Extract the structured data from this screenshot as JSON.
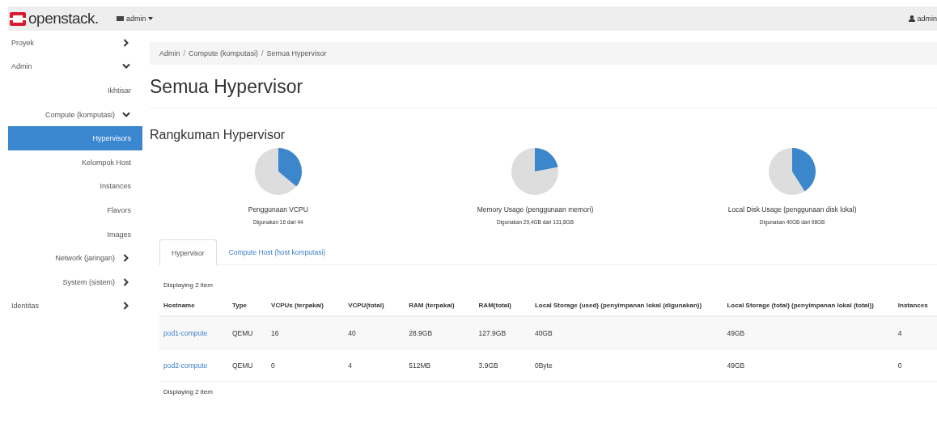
{
  "topbar": {
    "brand": "openstack.",
    "project_menu": "admin",
    "user_menu": "admin"
  },
  "sidebar": {
    "items": [
      {
        "label": "Proyek",
        "expanded": false,
        "selected": false
      },
      {
        "label": "Admin",
        "expanded": true,
        "selected": false,
        "children": [
          {
            "label": "Ikhtisar",
            "selected": false
          },
          {
            "label": "Compute (komputasi)",
            "expanded": true,
            "selected": false,
            "children": [
              {
                "label": "Hypervisors",
                "selected": true
              },
              {
                "label": "Kelompok Host",
                "selected": false
              },
              {
                "label": "Instances",
                "selected": false
              },
              {
                "label": "Flavors",
                "selected": false
              },
              {
                "label": "Images",
                "selected": false
              }
            ]
          },
          {
            "label": "Network (jaringan)",
            "expanded": false,
            "selected": false
          },
          {
            "label": "System (sistem)",
            "expanded": false,
            "selected": false
          }
        ]
      },
      {
        "label": "Identitas",
        "expanded": false,
        "selected": false
      }
    ]
  },
  "breadcrumb": [
    "Admin",
    "Compute (komputasi)",
    "Semua Hypervisor"
  ],
  "breadcrumb_separator": "/",
  "page_title": "Semua Hypervisor",
  "summary": {
    "title": "Rangkuman Hypervisor",
    "meters": [
      {
        "label": "Penggunaan VCPU",
        "detail": "Digunakan 16 dari 44"
      },
      {
        "label": "Memory Usage (penggunaan memori)",
        "detail": "Digunakan 29,4GB dari 131,8GB"
      },
      {
        "label": "Local Disk Usage (penggunaan disk lokal)",
        "detail": "Digunakan 40GB dari 98GB"
      }
    ]
  },
  "tabs": [
    {
      "label": "Hypervisor",
      "selected": true
    },
    {
      "label": "Compute Host (host komputasi)",
      "selected": false
    }
  ],
  "table": {
    "count_top": "Displaying 2 item",
    "count_bottom": "Displaying 2 item",
    "columns": [
      "Hostname",
      "Type",
      "VCPUs (terpakai)",
      "VCPU(total)",
      "RAM (terpakai)",
      "RAM(total)",
      "Local Storage (used) (penyimpanan lokal (digunakan))",
      "Local Storage (total) (penyimpanan lokal (total))",
      "Instances"
    ],
    "rows": [
      [
        "pod1-compute",
        "QEMU",
        "16",
        "40",
        "28.9GB",
        "127.9GB",
        "40GB",
        "49GB",
        "4"
      ],
      [
        "pod2-compute",
        "QEMU",
        "0",
        "4",
        "512MB",
        "3.9GB",
        "0Byte",
        "49GB",
        "0"
      ]
    ]
  }
}
